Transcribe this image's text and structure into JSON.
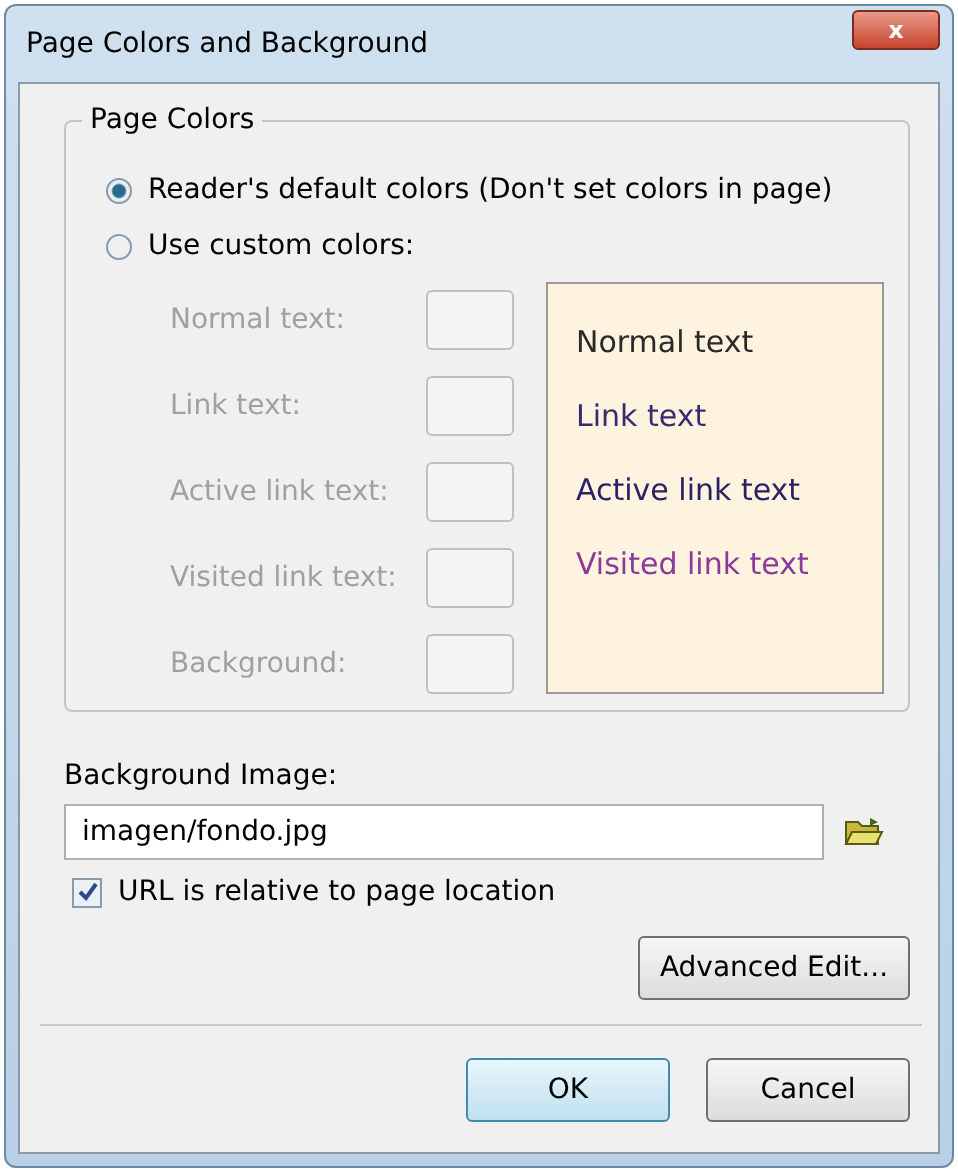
{
  "window": {
    "title": "Page Colors and Background",
    "close": "x"
  },
  "page_colors": {
    "title": "Page Colors",
    "options": [
      {
        "label": "Reader's default colors (Don't set colors in page)",
        "selected": true
      },
      {
        "label": "Use custom colors:",
        "selected": false
      }
    ],
    "rows": [
      {
        "label": "Normal text:",
        "disabled": true
      },
      {
        "label": "Link text:",
        "disabled": true
      },
      {
        "label": "Active link text:",
        "disabled": true
      },
      {
        "label": "Visited link text:",
        "disabled": true
      },
      {
        "label": "Background:",
        "disabled": true
      }
    ],
    "preview": [
      {
        "text": "Normal text",
        "color": "#2a2a2a"
      },
      {
        "text": "Link text",
        "color": "#3a2a72"
      },
      {
        "text": "Active link text",
        "color": "#2a2266"
      },
      {
        "text": "Visited link text",
        "color": "#8a3a9a"
      }
    ]
  },
  "background_image": {
    "label": "Background Image:",
    "value": "imagen/fondo.jpg",
    "relative": {
      "label": "URL is relative to page location",
      "checked": true
    }
  },
  "advanced_button": "Advanced Edit...",
  "buttons": [
    {
      "label": "OK",
      "selected": true
    },
    {
      "label": "Cancel",
      "selected": false
    }
  ]
}
